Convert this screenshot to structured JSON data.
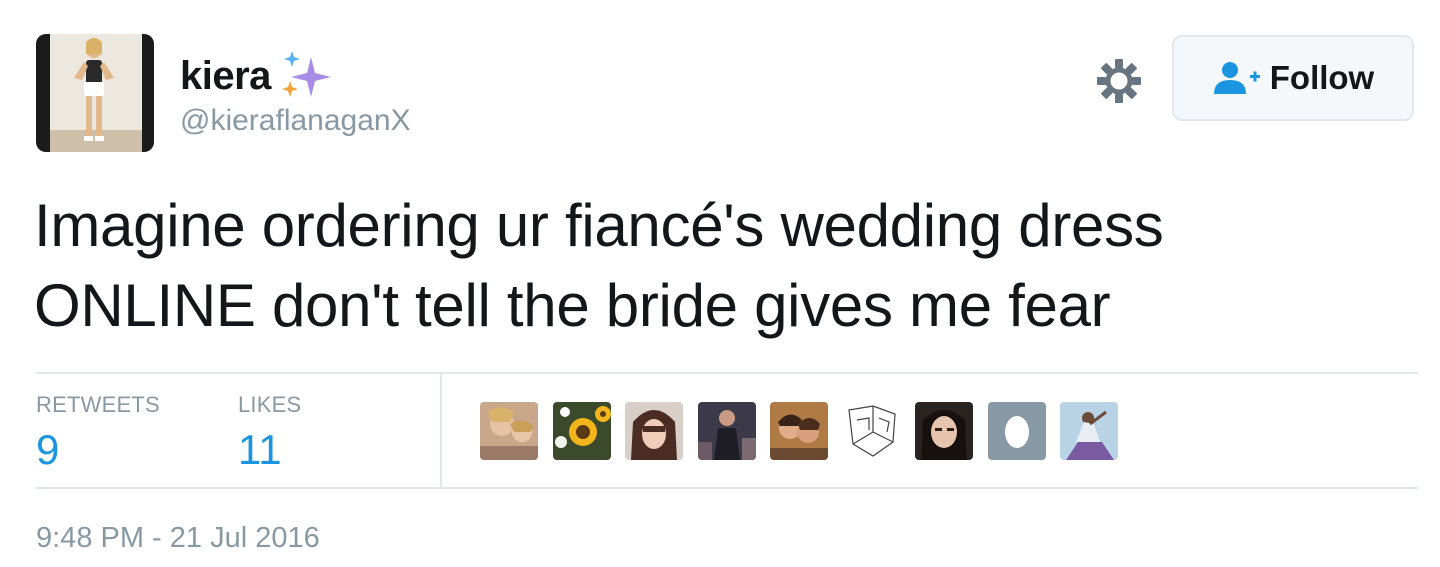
{
  "user": {
    "display_name": "kiera",
    "handle": "@kieraflanaganX",
    "avatar_icon": "profile-photo",
    "badge_icon": "sparkles-icon"
  },
  "actions": {
    "settings_icon": "gear-icon",
    "follow_label": "Follow",
    "follow_icon": "add-user-icon"
  },
  "tweet": {
    "text_lines": [
      "Imagine ordering ur fiancé's wedding dress",
      "ONLINE don't tell the bride gives me fear"
    ]
  },
  "stats": {
    "retweets_label": "RETWEETS",
    "retweets_count": "9",
    "likes_label": "LIKES",
    "likes_count": "11"
  },
  "likers": [
    {
      "icon": "liker-avatar-1"
    },
    {
      "icon": "liker-avatar-sunflowers"
    },
    {
      "icon": "liker-avatar-3"
    },
    {
      "icon": "liker-avatar-4"
    },
    {
      "icon": "liker-avatar-5"
    },
    {
      "icon": "liker-avatar-sketch"
    },
    {
      "icon": "liker-avatar-7"
    },
    {
      "icon": "default-egg-avatar"
    },
    {
      "icon": "liker-avatar-9"
    }
  ],
  "timestamp": "9:48 PM - 21 Jul 2016",
  "colors": {
    "link_blue": "#1b95e0",
    "muted_gray": "#8899a6",
    "border_gray": "#e1e8ed",
    "text_dark": "#14171a",
    "sparkle_purple": "#a98ce6",
    "sparkle_blue": "#5ab3f0",
    "sparkle_orange": "#f6a23a"
  }
}
